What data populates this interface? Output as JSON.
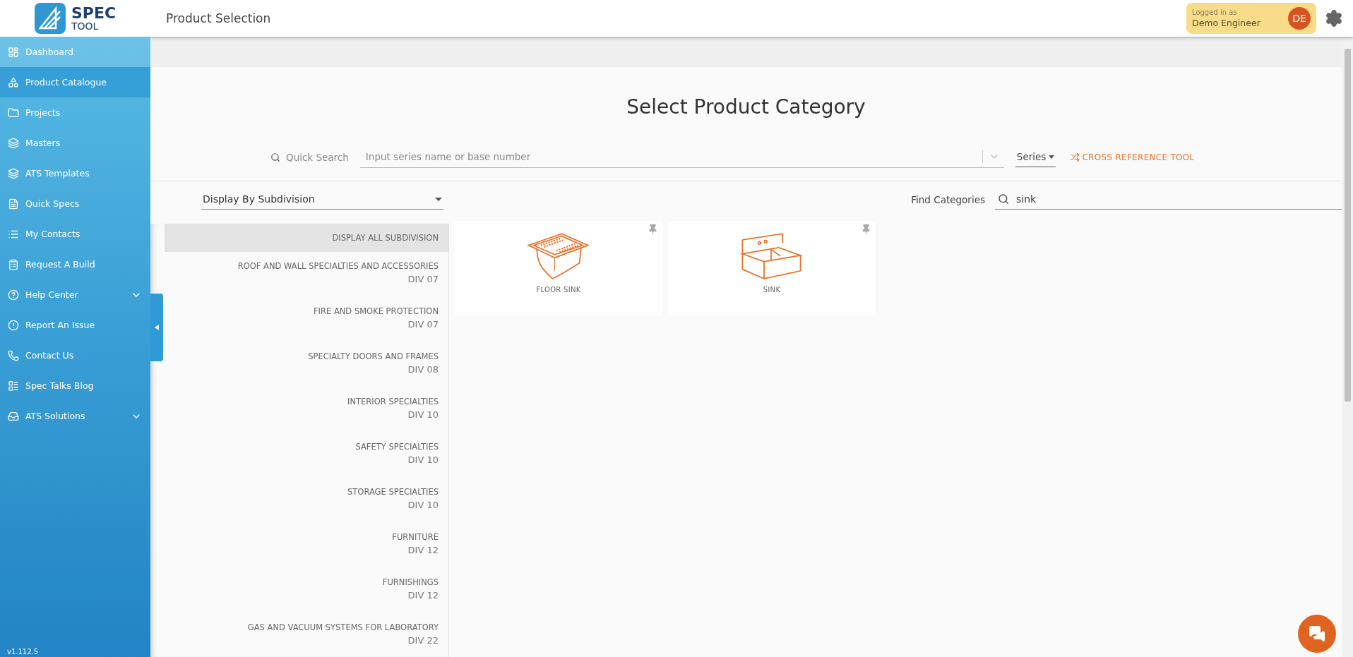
{
  "logo": {
    "line_1": "SPEC",
    "line_2": "TOOL"
  },
  "header": {
    "title": "Product Selection",
    "user": {
      "caption": "Logged in as",
      "name": "Demo Engineer",
      "initials": "DE"
    }
  },
  "sidebar": {
    "items": [
      {
        "label": "Dashboard",
        "kind": "link",
        "selected": false,
        "highlighted": true
      },
      {
        "label": "Product Catalogue",
        "kind": "link",
        "selected": true,
        "highlighted": false
      },
      {
        "label": "Projects",
        "kind": "link",
        "selected": false,
        "highlighted": false
      },
      {
        "label": "Masters",
        "kind": "link",
        "selected": false,
        "highlighted": false
      },
      {
        "label": "ATS Templates",
        "kind": "link",
        "selected": false,
        "highlighted": false
      },
      {
        "label": "Quick Specs",
        "kind": "link",
        "selected": false,
        "highlighted": false
      },
      {
        "label": "My Contacts",
        "kind": "link",
        "selected": false,
        "highlighted": false
      },
      {
        "label": "Request A Build",
        "kind": "link",
        "selected": false,
        "highlighted": false
      },
      {
        "label": "Help Center",
        "kind": "group",
        "selected": false,
        "highlighted": false
      },
      {
        "label": "Report An Issue",
        "kind": "link",
        "selected": false,
        "highlighted": false
      },
      {
        "label": "Contact Us",
        "kind": "link",
        "selected": false,
        "highlighted": false
      },
      {
        "label": "Spec Talks Blog",
        "kind": "link",
        "selected": false,
        "highlighted": false
      },
      {
        "label": "ATS Solutions",
        "kind": "group",
        "selected": false,
        "highlighted": false
      }
    ],
    "version": "v1.112.5"
  },
  "page_title": "Select Product Category",
  "quick_search": {
    "label": "Quick Search",
    "placeholder": "Input series name or base number",
    "scope": "Series",
    "cross_reference": "CROSS REFERENCE TOOL"
  },
  "display_by": {
    "value": "Display By Subdivision"
  },
  "find_categories": {
    "label": "Find Categories",
    "value": "sink"
  },
  "subdivisions": [
    {
      "name": "DISPLAY ALL SUBDIVISION",
      "selected": true
    },
    {
      "name": "ROOF AND WALL SPECIALTIES AND ACCESSORIES",
      "division": "DIV 07",
      "selected": false
    },
    {
      "name": "FIRE AND SMOKE PROTECTION",
      "division": "DIV 07",
      "selected": false
    },
    {
      "name": "SPECIALTY DOORS AND FRAMES",
      "division": "DIV 08",
      "selected": false
    },
    {
      "name": "INTERIOR SPECIALTIES",
      "division": "DIV 10",
      "selected": false
    },
    {
      "name": "SAFETY SPECIALTIES",
      "division": "DIV 10",
      "selected": false
    },
    {
      "name": "STORAGE SPECIALTIES",
      "division": "DIV 10",
      "selected": false
    },
    {
      "name": "FURNITURE",
      "division": "DIV 12",
      "selected": false
    },
    {
      "name": "FURNISHINGS",
      "division": "DIV 12",
      "selected": false
    },
    {
      "name": "GAS AND VACUUM SYSTEMS FOR LABORATORY",
      "division": "DIV 22",
      "selected": false
    }
  ],
  "categories": [
    {
      "name": "FLOOR SINK",
      "kind": "floor-sink"
    },
    {
      "name": "SINK",
      "kind": "sink"
    }
  ]
}
